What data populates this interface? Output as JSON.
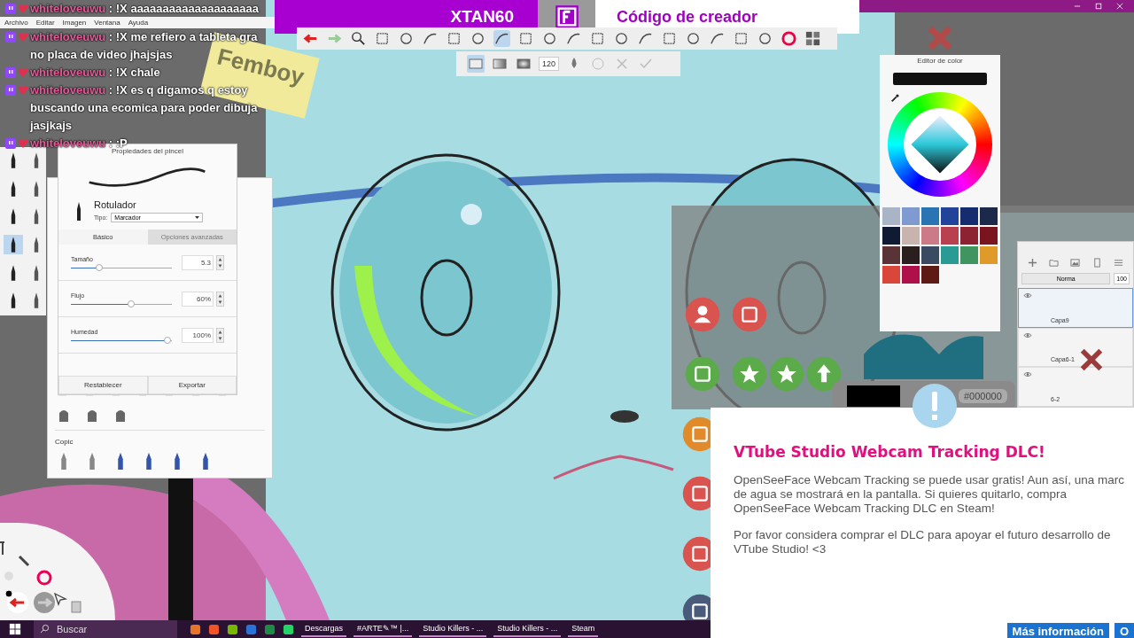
{
  "app_menu": [
    "Archivo",
    "Editar",
    "Imagen",
    "Ventana",
    "Ayuda"
  ],
  "chat": [
    {
      "user": "whiteloveuwu",
      "text": ": !X aaaaaaaaaaaaaaaaaaaa"
    },
    {
      "user": "whiteloveuwu",
      "text": ": !X me refiero a tableta gra no placa de video jhajsjas"
    },
    {
      "user": "whiteloveuwu",
      "text": ": !X chale"
    },
    {
      "user": "whiteloveuwu",
      "text": ": !X es q digamos q estoy buscando una ecomica para poder dibuja jasjkajs"
    },
    {
      "user": "whiteloveuwu",
      "text": ": :P"
    }
  ],
  "banner": {
    "name": "XTAN60",
    "label": "Código de creador"
  },
  "toolbar": {
    "brush_size": "120"
  },
  "canvas": {
    "note": "Femboy"
  },
  "brush_panel": {
    "title": "Propiedades del pincel",
    "brush": "Rotulador",
    "type_label": "Tipo:",
    "type_value": "Marcador",
    "tabs": [
      {
        "label": "Básico",
        "selected": true
      },
      {
        "label": "Opciones avanzadas",
        "selected": false
      }
    ],
    "sliders": [
      {
        "label": "Tamaño",
        "level": 0.28,
        "reading": "5.3"
      },
      {
        "label": "Flujo",
        "level": 0.6,
        "reading": "60%"
      },
      {
        "label": "Humedad",
        "level": 0.96,
        "reading": "100%"
      }
    ],
    "buttons": [
      "Restablecer",
      "Exportar"
    ]
  },
  "brush_library": {
    "section": "Copic"
  },
  "color_editor": {
    "title": "Editor de color",
    "swatches": [
      {
        "color": "#a9b4c6"
      },
      {
        "color": "#7f9ad0"
      },
      {
        "color": "#2a74b4"
      },
      {
        "color": "#22439a"
      },
      {
        "color": "#152c6e"
      },
      {
        "color": "#1b2a4a"
      },
      {
        "color": "#101a33"
      },
      {
        "color": "#c9b3ae"
      },
      {
        "color": "#cc7b86"
      },
      {
        "color": "#b9404f"
      },
      {
        "color": "#8c2232"
      },
      {
        "color": "#7a1520"
      },
      {
        "color": "#5a3337"
      },
      {
        "color": "#2b1e1e"
      },
      {
        "color": "#3a4a60"
      },
      {
        "color": "#2a9a95"
      },
      {
        "color": "#3f9460"
      },
      {
        "color": "#e09a2a"
      },
      {
        "color": "#d8473a"
      },
      {
        "color": "#b0104a"
      },
      {
        "color": "#5e1a14"
      }
    ]
  },
  "layers": {
    "blend_mode": "Norma",
    "opacity": "100",
    "items": [
      {
        "name": "Capa9",
        "selected": true
      },
      {
        "name": "Capa6-1",
        "selected": false
      },
      {
        "name": "6-2",
        "selected": false
      }
    ]
  },
  "color_popup": {
    "hex": "#000000"
  },
  "dialog": {
    "title": "VTube Studio Webcam Tracking DLC!",
    "paragraphs": [
      "OpenSeeFace Webcam Tracking se puede usar gratis! Aun así, una marc de agua se mostrará en la pantalla. Si quieres quitarlo, compra OpenSeeFace Webcam Tracking DLC en Steam!",
      "Por favor considera comprar el DLC para apoyar el futuro desarrollo de VTube Studio! <3"
    ],
    "buttons": [
      "Más información",
      "O"
    ]
  },
  "taskbar": {
    "search_placeholder": "Buscar",
    "items": [
      {
        "label": "Descargas"
      },
      {
        "label": "#ARTE✎™ |..."
      },
      {
        "label": "Studio Killers - ..."
      },
      {
        "label": "Studio Killers - ..."
      },
      {
        "label": "Steam"
      }
    ]
  }
}
